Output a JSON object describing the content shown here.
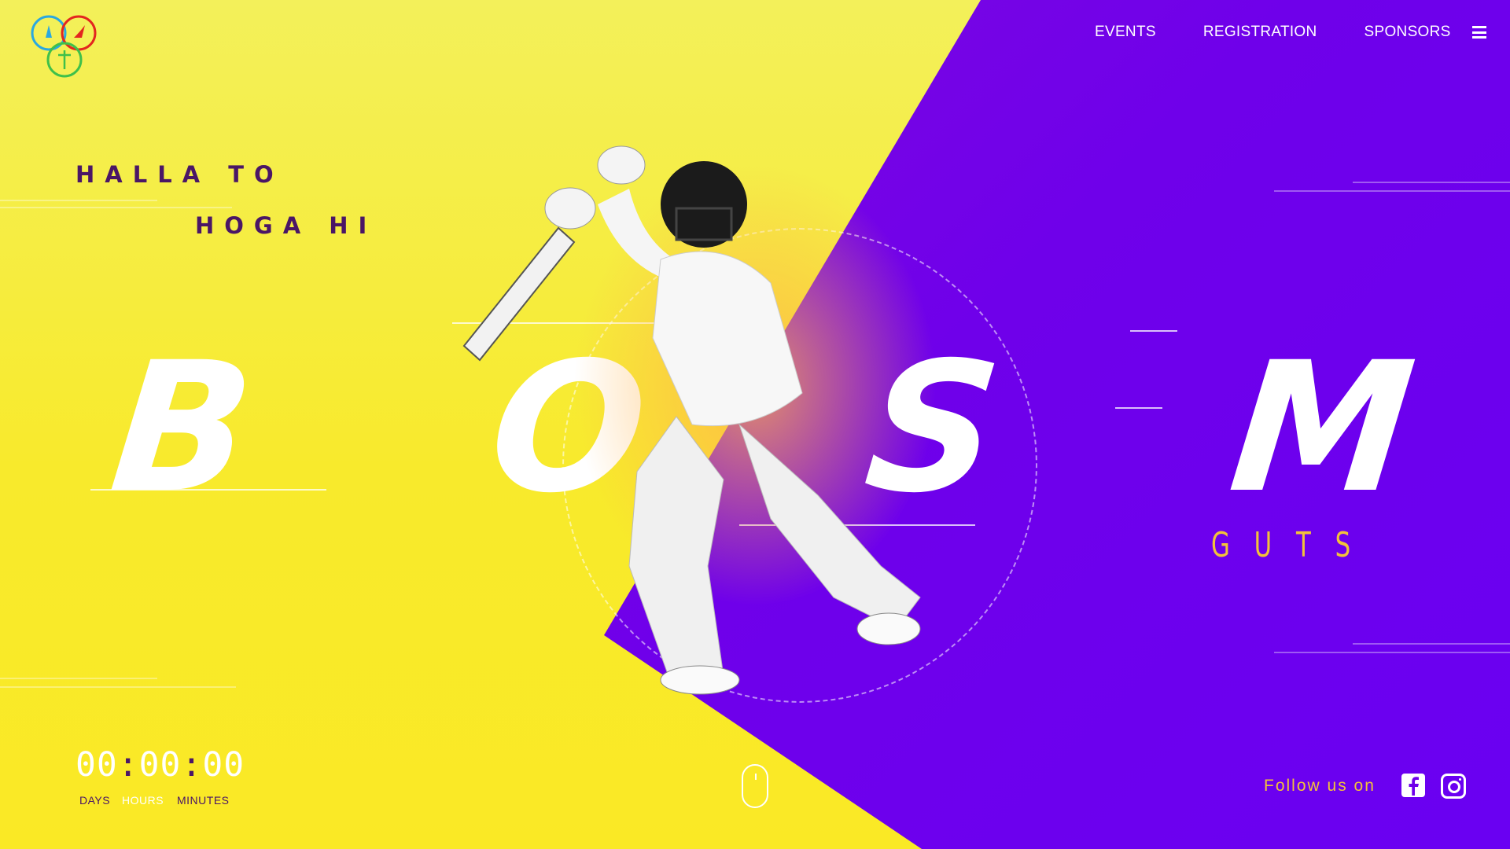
{
  "nav": {
    "items": [
      "EVENTS",
      "REGISTRATION",
      "SPONSORS"
    ],
    "menu_icon": "hamburger-icon"
  },
  "logo": {
    "name": "fest-logo",
    "rings": [
      "#2aa8e0",
      "#e3261f",
      "#3fc04a"
    ]
  },
  "tagline": {
    "line1": "HALLA TO",
    "line2": "HOGA HI"
  },
  "hero": {
    "letters": [
      "B",
      "O",
      "S",
      "M"
    ],
    "subtitle": "GUTS"
  },
  "countdown": {
    "days": "00",
    "hours": "00",
    "minutes": "00",
    "labels": {
      "days": "DAYS",
      "hours": "HOURS",
      "minutes": "MINUTES"
    }
  },
  "footer": {
    "follow_text": "Follow us on",
    "social": [
      "facebook-icon",
      "instagram-icon"
    ]
  },
  "colors": {
    "yellow": "#f8ea2c",
    "purple": "#6f00ea",
    "accent": "#f2c23a",
    "dark": "#4a1666"
  }
}
